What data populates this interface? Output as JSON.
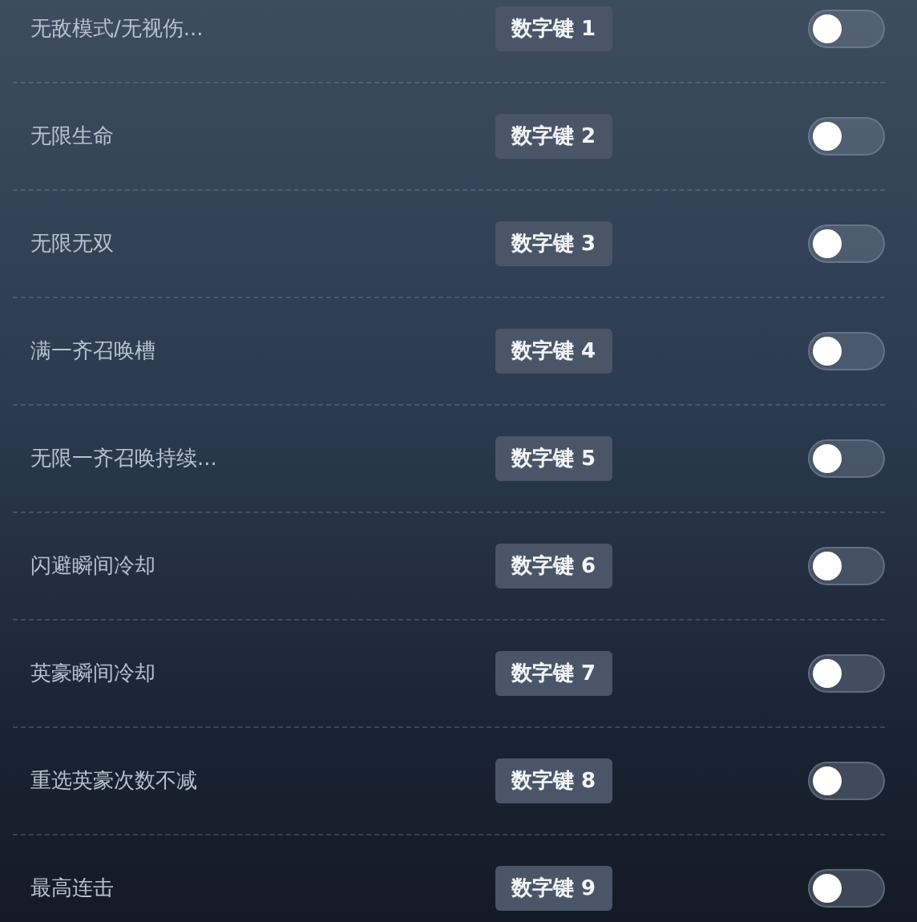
{
  "cheats": [
    {
      "label": "无敌模式/无视伤...",
      "hotkey": "数字键 1",
      "on": false
    },
    {
      "label": "无限生命",
      "hotkey": "数字键 2",
      "on": false
    },
    {
      "label": "无限无双",
      "hotkey": "数字键 3",
      "on": false
    },
    {
      "label": "满一齐召唤槽",
      "hotkey": "数字键 4",
      "on": false
    },
    {
      "label": "无限一齐召唤持续...",
      "hotkey": "数字键 5",
      "on": false
    },
    {
      "label": "闪避瞬间冷却",
      "hotkey": "数字键 6",
      "on": false
    },
    {
      "label": "英豪瞬间冷却",
      "hotkey": "数字键 7",
      "on": false
    },
    {
      "label": "重选英豪次数不减",
      "hotkey": "数字键 8",
      "on": false
    },
    {
      "label": "最高连击",
      "hotkey": "数字键 9",
      "on": false
    }
  ]
}
